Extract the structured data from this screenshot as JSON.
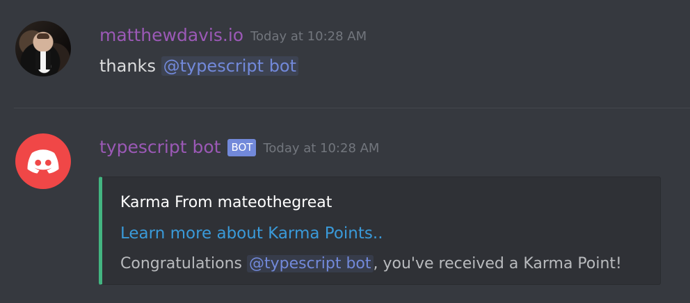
{
  "messages": [
    {
      "avatar_icon": "user-photo-avatar",
      "author": "matthewdavis.io",
      "timestamp": "Today at 10:28 AM",
      "content": {
        "text": "thanks ",
        "mention": "@typescript bot"
      }
    },
    {
      "avatar_icon": "discord-logo-icon",
      "author": "typescript bot",
      "badge": "BOT",
      "timestamp": "Today at 10:28 AM",
      "embed": {
        "title": "Karma From mateothegreat",
        "link_text": "Learn more about Karma Points..",
        "description_prefix": "Congratulations ",
        "mention": "@typescript bot",
        "description_suffix": ", you've received a Karma Point!",
        "accent_color": "#43b581"
      }
    }
  ],
  "colors": {
    "background": "#36393f",
    "username": "#9b59b6",
    "timestamp": "#72767d",
    "mention": "#7289da",
    "link": "#3a9ad9",
    "discord_avatar": "#f04747"
  }
}
